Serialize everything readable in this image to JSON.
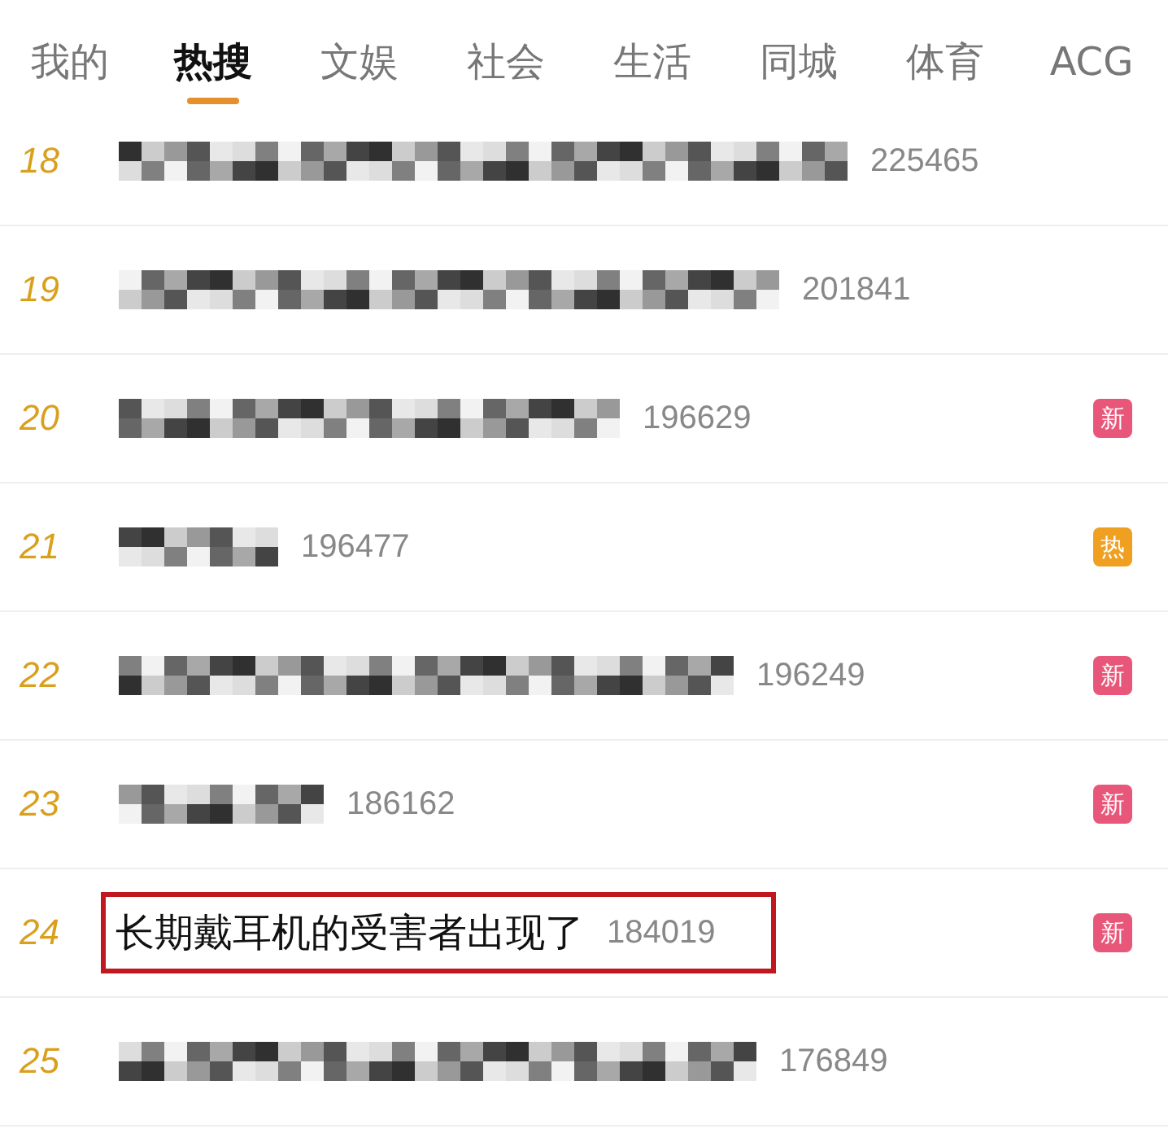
{
  "tabs": [
    {
      "label": "我的",
      "selected": false
    },
    {
      "label": "热搜",
      "selected": true
    },
    {
      "label": "文娱",
      "selected": false
    },
    {
      "label": "社会",
      "selected": false
    },
    {
      "label": "生活",
      "selected": false
    },
    {
      "label": "同城",
      "selected": false
    },
    {
      "label": "体育",
      "selected": false
    },
    {
      "label": "ACG",
      "selected": false
    }
  ],
  "rows": [
    {
      "rank": "18",
      "kind": "redacted",
      "count": "225465"
    },
    {
      "rank": "19",
      "kind": "redacted",
      "count": "201841"
    },
    {
      "rank": "20",
      "kind": "redacted",
      "count": "196629",
      "badge": {
        "text": "新",
        "color": "#e8577a"
      }
    },
    {
      "rank": "21",
      "kind": "redacted",
      "count": "196477",
      "badge": {
        "text": "热",
        "color": "#f0a020"
      }
    },
    {
      "rank": "22",
      "kind": "redacted",
      "count": "196249",
      "badge": {
        "text": "新",
        "color": "#e8577a"
      }
    },
    {
      "rank": "23",
      "kind": "redacted",
      "count": "186162",
      "badge": {
        "text": "新",
        "color": "#e8577a"
      }
    },
    {
      "rank": "24",
      "kind": "text",
      "title": "长期戴耳机的受害者出现了",
      "count": "184019",
      "highlighted": true,
      "badge": {
        "text": "新",
        "color": "#e8577a"
      }
    },
    {
      "rank": "25",
      "kind": "redacted",
      "count": "176849"
    }
  ]
}
